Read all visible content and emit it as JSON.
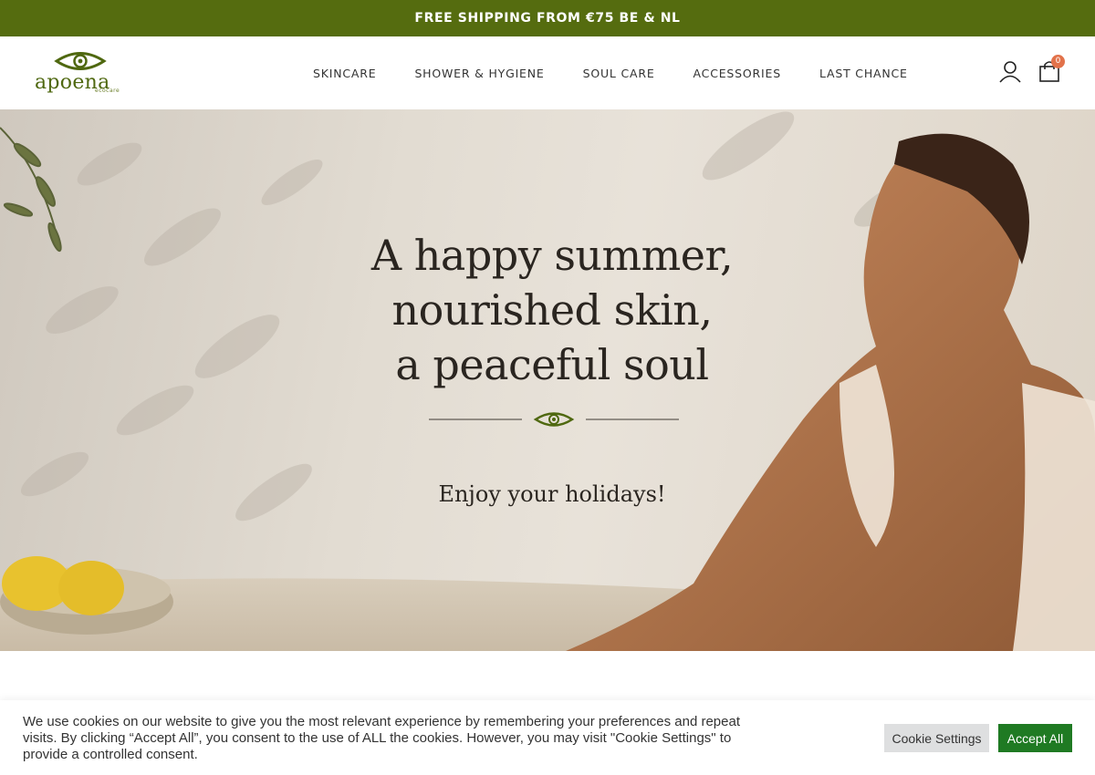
{
  "topbar": {
    "text": "FREE SHIPPING FROM €75 BE & NL"
  },
  "brand": {
    "name": "apoena",
    "subtitle": "ecocare",
    "color": "#556c0f"
  },
  "nav": {
    "items": [
      {
        "label": "SKINCARE"
      },
      {
        "label": "SHOWER & HYGIENE"
      },
      {
        "label": "SOUL CARE"
      },
      {
        "label": "ACCESSORIES"
      },
      {
        "label": "LAST CHANCE"
      }
    ]
  },
  "header_icons": {
    "account": "user-icon",
    "cart": "shopping-bag-icon",
    "cart_count": "0"
  },
  "hero": {
    "line1": "A happy summer,",
    "line2": "nourished skin,",
    "line3": "a peaceful soul",
    "subtitle": "Enjoy your holidays!"
  },
  "cookie": {
    "text": "We use cookies on our website to give you the most relevant experience by remembering your preferences and repeat visits. By clicking “Accept All”, you consent to the use of ALL the cookies. However, you may visit \"Cookie Settings\" to provide a controlled consent.",
    "settings_label": "Cookie Settings",
    "accept_label": "Accept All",
    "accept_color": "#1f7a23"
  }
}
